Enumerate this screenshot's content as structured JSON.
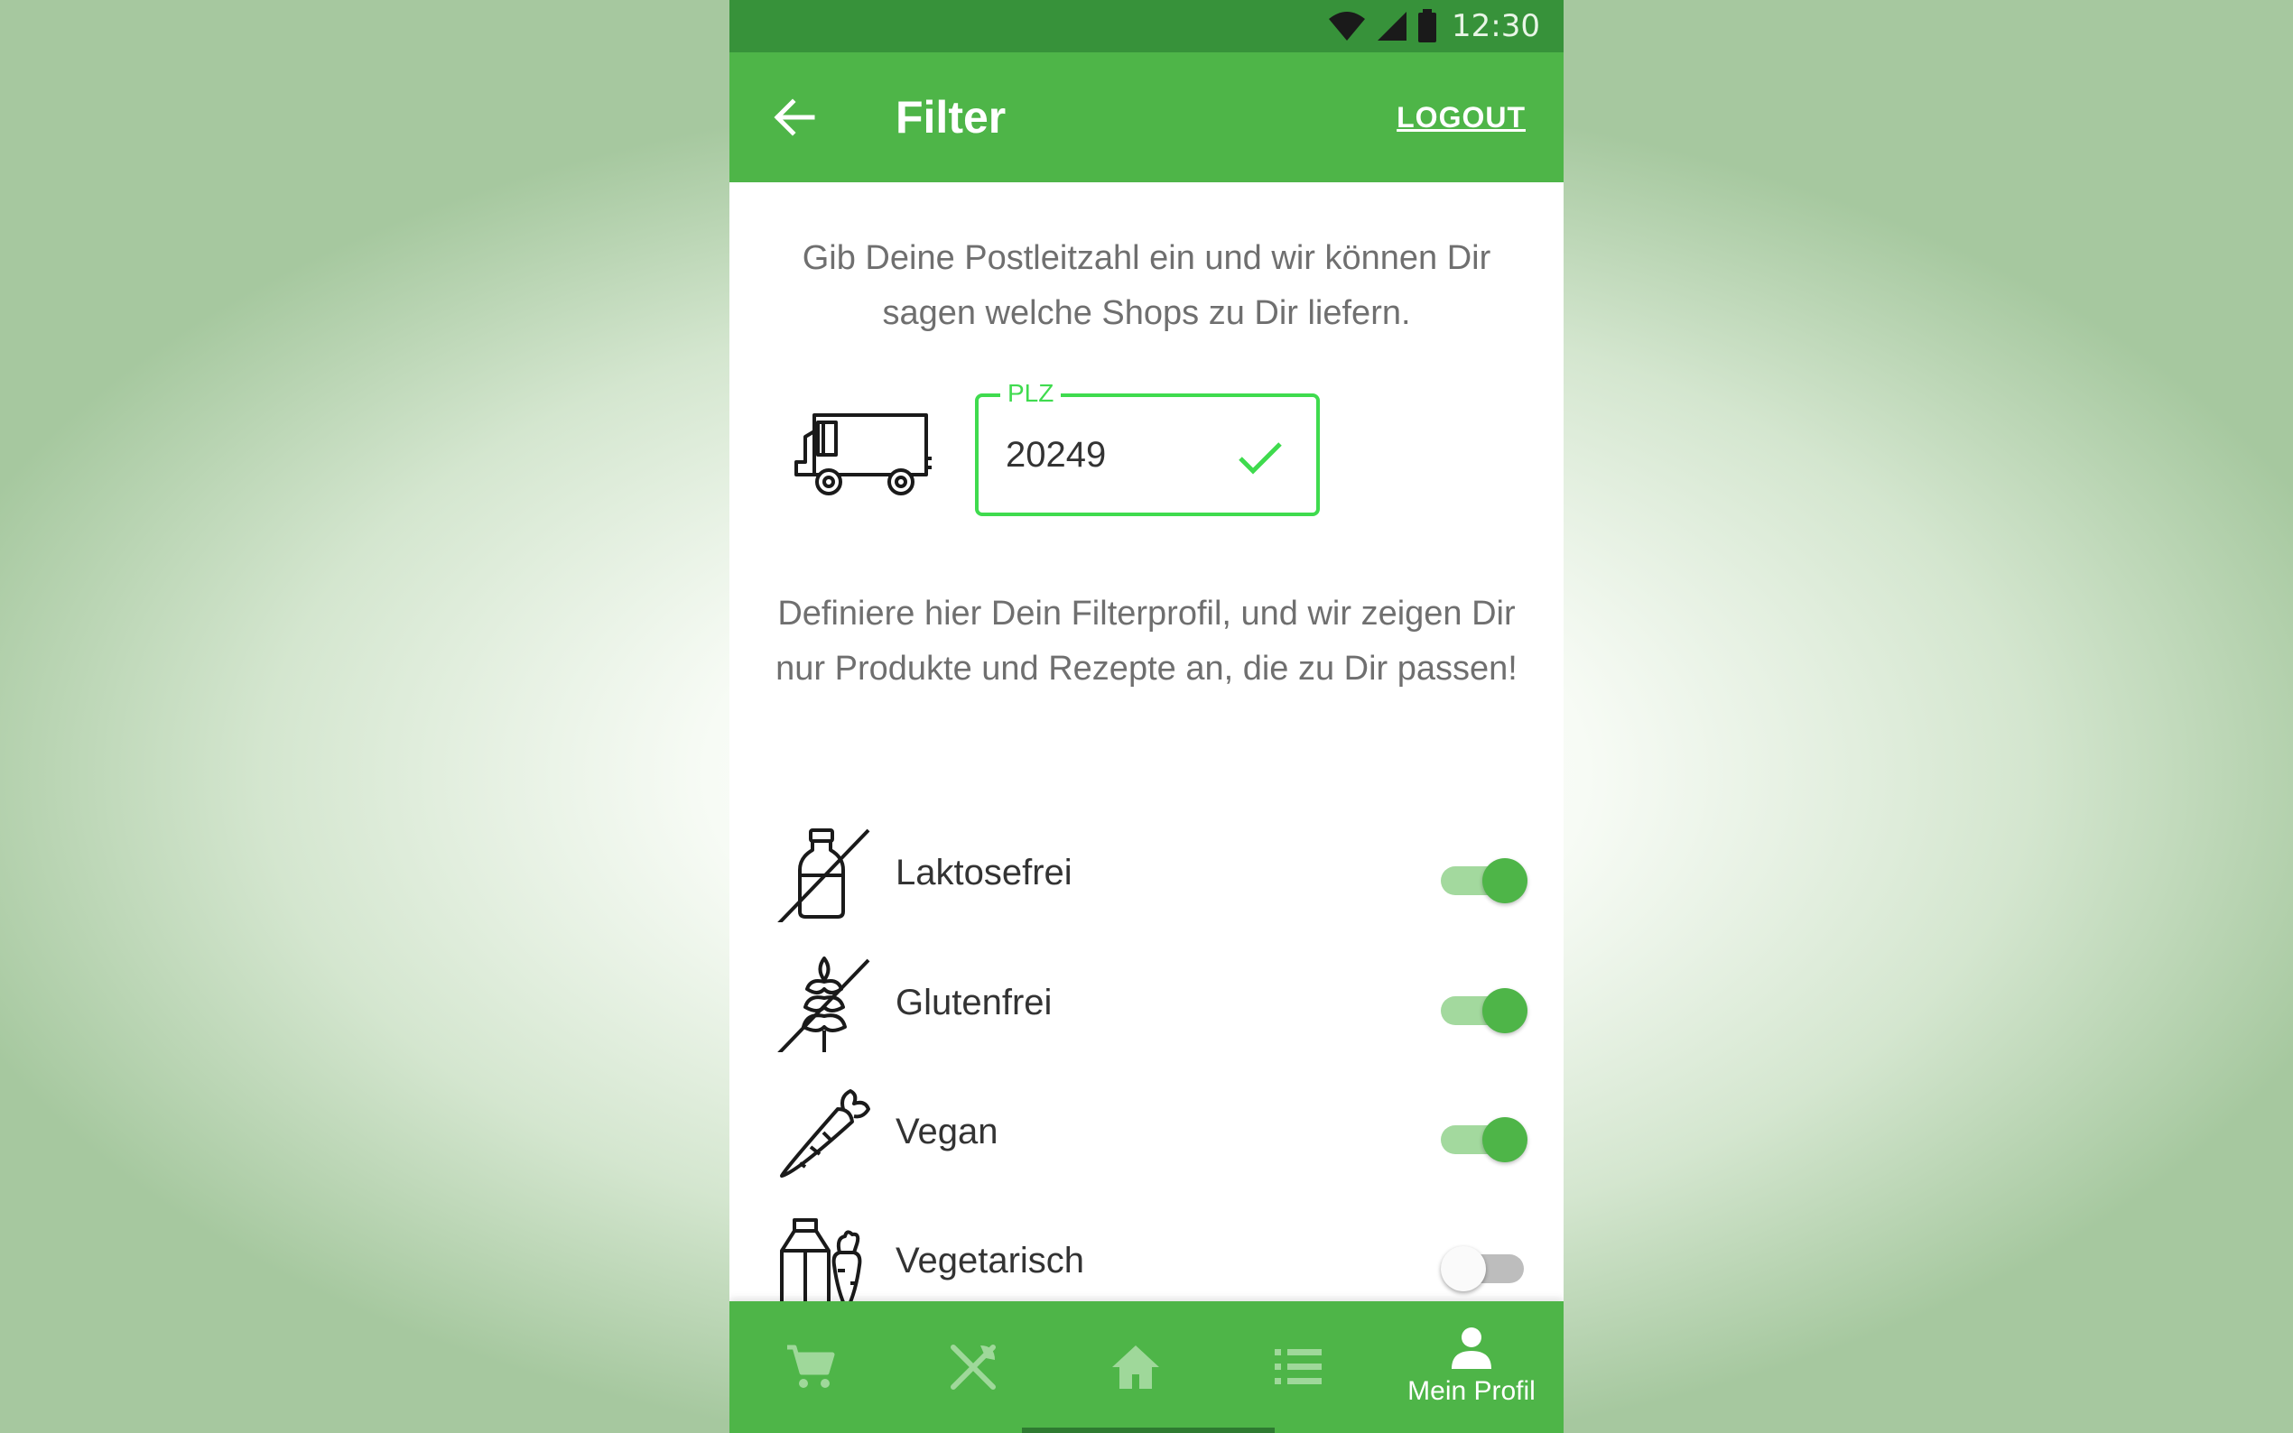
{
  "status_bar": {
    "time": "12:30",
    "icons": [
      "wifi-icon",
      "signal-icon",
      "battery-icon"
    ]
  },
  "app_bar": {
    "title": "Filter",
    "logout_label": "LOGOUT",
    "back_icon": "arrow-left-icon"
  },
  "intro_text": "Gib Deine Postleitzahl ein und wir können Dir sagen welche Shops zu Dir liefern.",
  "plz": {
    "label": "PLZ",
    "value": "20249",
    "icon": "truck-icon",
    "check_icon": "checkmark-icon"
  },
  "filter_text": "Definiere hier Dein Filterprofil, und wir zeigen Dir nur Produkte und Rezepte an, die zu Dir passen!",
  "filters": [
    {
      "label": "Laktosefrei",
      "icon": "milk-bottle-crossed-icon",
      "enabled": true
    },
    {
      "label": "Glutenfrei",
      "icon": "wheat-crossed-icon",
      "enabled": true
    },
    {
      "label": "Vegan",
      "icon": "carrot-icon",
      "enabled": true
    },
    {
      "label": "Vegetarisch",
      "icon": "milk-carton-carrot-icon",
      "enabled": false
    }
  ],
  "bottom_nav": [
    {
      "icon": "cart-icon",
      "label": ""
    },
    {
      "icon": "fork-knife-icon",
      "label": ""
    },
    {
      "icon": "home-icon",
      "label": ""
    },
    {
      "icon": "list-icon",
      "label": ""
    },
    {
      "icon": "person-icon",
      "label": "Mein Profil"
    }
  ],
  "colors": {
    "primary": "#4eb548",
    "status_bar": "#37923a",
    "accent_green": "#3fdb4e",
    "text_gray": "#6f6f6f"
  }
}
